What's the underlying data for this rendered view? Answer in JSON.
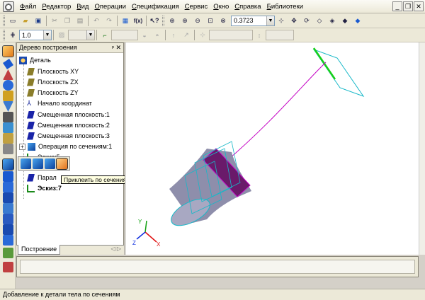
{
  "menu": {
    "items": [
      {
        "label": "Файл",
        "key": "Ф",
        "rest": "айл"
      },
      {
        "label": "Редактор",
        "key": "Р",
        "rest": "едактор"
      },
      {
        "label": "Вид",
        "key": "В",
        "rest": "ид"
      },
      {
        "label": "Операции",
        "key": "О",
        "rest": "перации"
      },
      {
        "label": "Спецификация",
        "key": "С",
        "rest": "пецификация"
      },
      {
        "label": "Сервис",
        "key": "С",
        "rest": "ервис"
      },
      {
        "label": "Окно",
        "key": "О",
        "rest": "кно"
      },
      {
        "label": "Справка",
        "key": "С",
        "rest": "правка"
      },
      {
        "label": "Библиотеки",
        "key": "Б",
        "rest": "иблиотеки"
      }
    ]
  },
  "toolbar": {
    "zoom_value": "0.3723",
    "step_value": "1.0"
  },
  "tree": {
    "title": "Дерево построения",
    "root": "Деталь",
    "items": [
      {
        "label": "Плоскость XY",
        "icon": "plane"
      },
      {
        "label": "Плоскость ZX",
        "icon": "plane"
      },
      {
        "label": "Плоскость ZY",
        "icon": "plane"
      },
      {
        "label": "Начало координат",
        "icon": "origin"
      },
      {
        "label": "Смещенная плоскость:1",
        "icon": "offset-plane"
      },
      {
        "label": "Смещенная плоскость:2",
        "icon": "offset-plane"
      },
      {
        "label": "Смещенная плоскость:3",
        "icon": "offset-plane"
      },
      {
        "label": "Операция по сечениям:1",
        "icon": "loft"
      },
      {
        "label": "Эскиз:5",
        "icon": "sketch"
      },
      {
        "label": "Парал",
        "icon": "offset-plane"
      },
      {
        "label": "Эскиз:7",
        "icon": "sketch"
      }
    ],
    "tab_label": "Построение"
  },
  "tooltip": "Приклеить по сечениям",
  "status": "Добавление к детали тела по сечениям",
  "axes": {
    "x": "X",
    "y": "Y",
    "z": "Z"
  },
  "colors": {
    "accent": "#0a3f9a",
    "path": "#c400c4",
    "section": "#18b8c8",
    "body": "#8a8aa6",
    "axis_x": "#e01010",
    "axis_y": "#10a010",
    "axis_z": "#1030e0"
  }
}
